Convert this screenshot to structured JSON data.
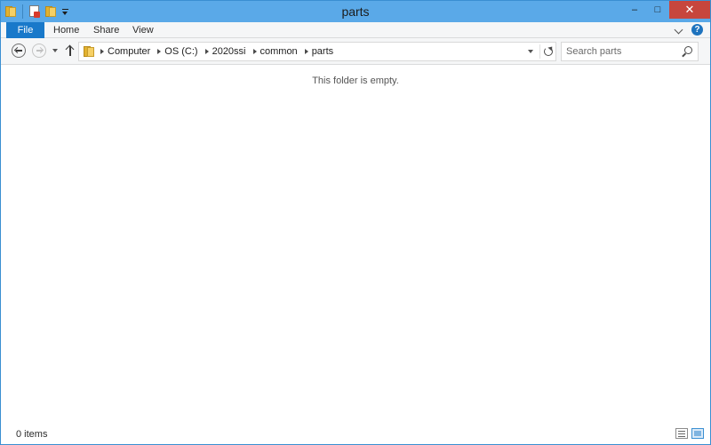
{
  "window": {
    "title": "parts"
  },
  "quick_access": [
    {
      "icon": "folder-icon"
    },
    {
      "icon": "properties-icon"
    },
    {
      "icon": "new-folder-icon"
    }
  ],
  "window_controls": {
    "minimize": "–",
    "maximize": "□",
    "close": "✕"
  },
  "ribbon": {
    "tabs": [
      {
        "label": "File"
      },
      {
        "label": "Home"
      },
      {
        "label": "Share"
      },
      {
        "label": "View"
      }
    ],
    "help": "?"
  },
  "address_bar": {
    "breadcrumbs": [
      "Computer",
      "OS (C:)",
      "2020ssi",
      "common",
      "parts"
    ]
  },
  "search": {
    "placeholder": "Search parts"
  },
  "content": {
    "empty_message": "This folder is empty."
  },
  "status_bar": {
    "item_count": "0 items"
  },
  "colors": {
    "title_bar": "#5aa9e8",
    "file_tab": "#1979ca",
    "close_button": "#c7463d",
    "help": "#1e73be"
  }
}
